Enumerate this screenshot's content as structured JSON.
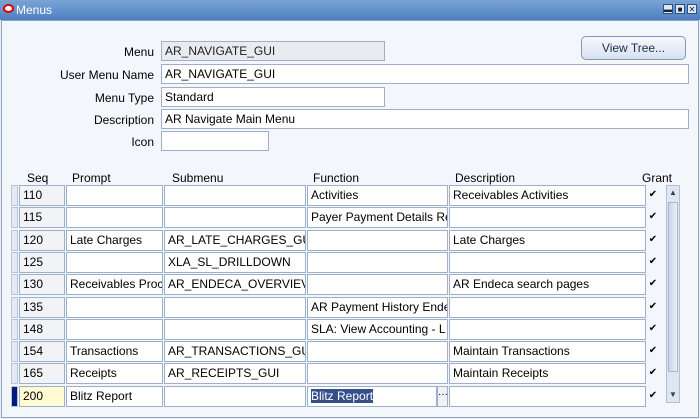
{
  "window": {
    "title": "Menus",
    "minimize_icon": "minimize-icon",
    "maximize_icon": "maximize-icon",
    "close_icon": "close-icon"
  },
  "form": {
    "menu_label": "Menu",
    "menu_value": "AR_NAVIGATE_GUI",
    "user_menu_name_label": "User Menu Name",
    "user_menu_name_value": "AR_NAVIGATE_GUI",
    "menu_type_label": "Menu Type",
    "menu_type_value": "Standard",
    "description_label": "Description",
    "description_value": "AR Navigate Main Menu",
    "icon_label": "Icon",
    "icon_value": "",
    "view_tree_label": "View Tree..."
  },
  "table": {
    "headers": {
      "seq": "Seq",
      "prompt": "Prompt",
      "submenu": "Submenu",
      "function": "Function",
      "description": "Description",
      "grant": "Grant"
    },
    "rows": [
      {
        "seq": "110",
        "prompt": "",
        "submenu": "",
        "function": "Activities",
        "description": "Receivables Activities",
        "grant": true
      },
      {
        "seq": "115",
        "prompt": "",
        "submenu": "",
        "function": "Payer Payment Details Re",
        "description": "",
        "grant": true
      },
      {
        "seq": "120",
        "prompt": "Late Charges",
        "submenu": "AR_LATE_CHARGES_GU",
        "function": "",
        "description": "Late Charges",
        "grant": true
      },
      {
        "seq": "125",
        "prompt": "",
        "submenu": "XLA_SL_DRILLDOWN",
        "function": "",
        "description": "",
        "grant": true
      },
      {
        "seq": "130",
        "prompt": "Receivables Proc",
        "submenu": "AR_ENDECA_OVERVIEV",
        "function": "",
        "description": "AR Endeca search pages",
        "grant": true
      },
      {
        "seq": "135",
        "prompt": "",
        "submenu": "",
        "function": "AR Payment History Ende",
        "description": "",
        "grant": true
      },
      {
        "seq": "148",
        "prompt": "",
        "submenu": "",
        "function": "SLA: View Accounting - L",
        "description": "",
        "grant": true
      },
      {
        "seq": "154",
        "prompt": "Transactions",
        "submenu": "AR_TRANSACTIONS_GU",
        "function": "",
        "description": "Maintain Transactions",
        "grant": true
      },
      {
        "seq": "165",
        "prompt": "Receipts",
        "submenu": "AR_RECEIPTS_GUI",
        "function": "",
        "description": "Maintain Receipts",
        "grant": true
      },
      {
        "seq": "200",
        "prompt": "Blitz Report",
        "submenu": "",
        "function": "Blitz Report",
        "description": "",
        "grant": true,
        "current": true
      }
    ]
  },
  "glyphs": {
    "check": "✔",
    "lov": "···",
    "up": "▲",
    "down": "▼",
    "min": "▬",
    "max": "■",
    "close": "✕"
  }
}
